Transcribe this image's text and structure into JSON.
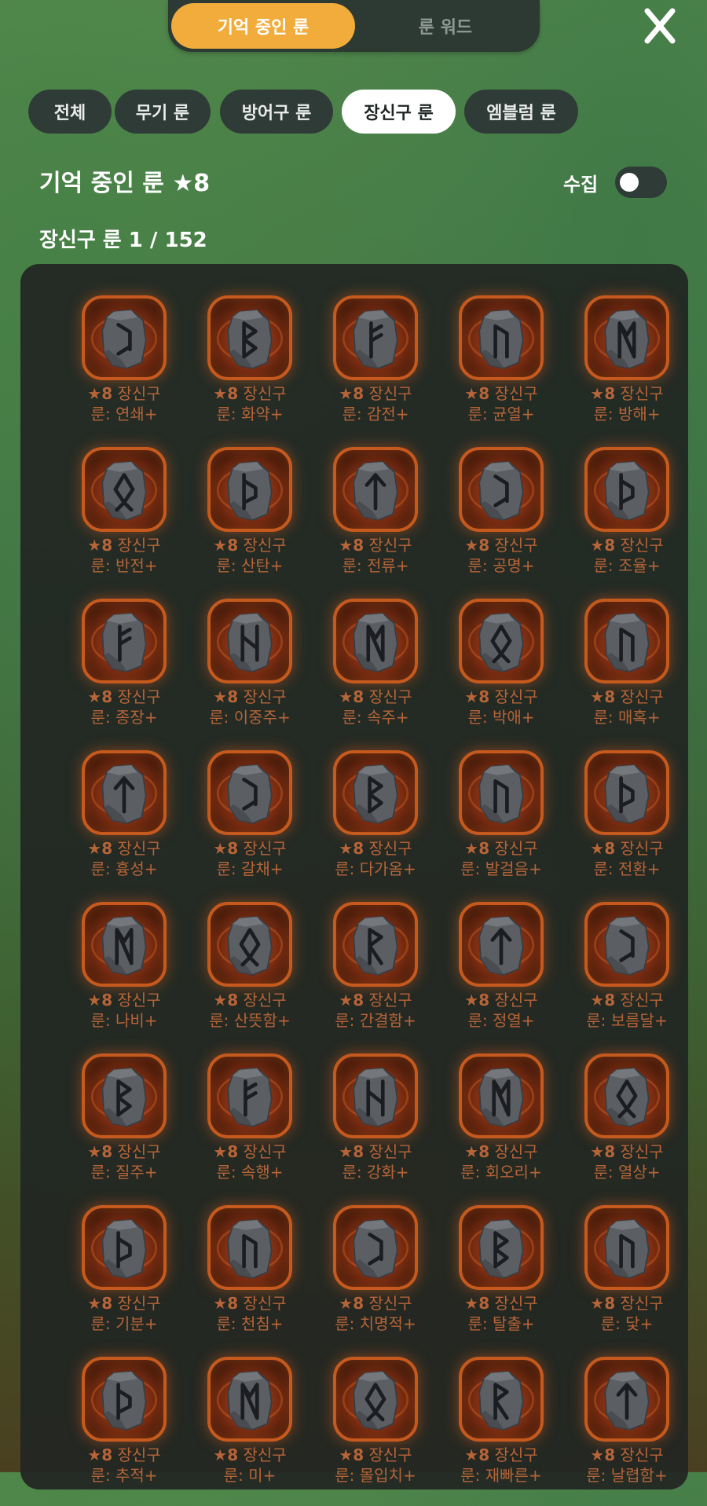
{
  "tabs": {
    "active": "기억 중인 룬",
    "inactive": "룬 워드"
  },
  "filters": [
    "전체",
    "무기 룬",
    "방어구 룬",
    "장신구 룬",
    "엠블럼 룬"
  ],
  "active_filter_index": 3,
  "header": {
    "title": "기억 중인 룬 ★8",
    "collect_label": "수집",
    "collect_toggle_on": false
  },
  "count": {
    "text": "장신구 룬  1 / 152"
  },
  "colors": {
    "accent": "#f2ac3c",
    "label": "#b66438",
    "tile_border": "#c65a1e",
    "panel": "#212622"
  },
  "runes": [
    {
      "star": "★8",
      "type": "장신구",
      "name": "룬: 연쇄+",
      "glyph": "eihwaz"
    },
    {
      "star": "★8",
      "type": "장신구",
      "name": "룬: 화약+",
      "glyph": "berkano"
    },
    {
      "star": "★8",
      "type": "장신구",
      "name": "룬: 감전+",
      "glyph": "fehu"
    },
    {
      "star": "★8",
      "type": "장신구",
      "name": "룬: 균열+",
      "glyph": "uruz"
    },
    {
      "star": "★8",
      "type": "장신구",
      "name": "룬: 방해+",
      "glyph": "mannaz"
    },
    {
      "star": "★8",
      "type": "장신구",
      "name": "룬: 반전+",
      "glyph": "othala"
    },
    {
      "star": "★8",
      "type": "장신구",
      "name": "룬: 산탄+",
      "glyph": "thurisaz"
    },
    {
      "star": "★8",
      "type": "장신구",
      "name": "룬: 전류+",
      "glyph": "tiwaz"
    },
    {
      "star": "★8",
      "type": "장신구",
      "name": "룬: 공명+",
      "glyph": "eihwaz"
    },
    {
      "star": "★8",
      "type": "장신구",
      "name": "룬: 조율+",
      "glyph": "thurisaz"
    },
    {
      "star": "★8",
      "type": "장신구",
      "name": "룬: 종장+",
      "glyph": "fehu"
    },
    {
      "star": "★8",
      "type": "장신구",
      "name": "룬: 이중주+",
      "glyph": "hagalaz"
    },
    {
      "star": "★8",
      "type": "장신구",
      "name": "룬: 속주+",
      "glyph": "mannaz"
    },
    {
      "star": "★8",
      "type": "장신구",
      "name": "룬: 박애+",
      "glyph": "othala"
    },
    {
      "star": "★8",
      "type": "장신구",
      "name": "룬: 매혹+",
      "glyph": "uruz"
    },
    {
      "star": "★8",
      "type": "장신구",
      "name": "룬: 흉성+",
      "glyph": "tiwaz"
    },
    {
      "star": "★8",
      "type": "장신구",
      "name": "룬: 갈채+",
      "glyph": "eihwaz"
    },
    {
      "star": "★8",
      "type": "장신구",
      "name": "룬: 다가옴+",
      "glyph": "berkano"
    },
    {
      "star": "★8",
      "type": "장신구",
      "name": "룬: 발걸음+",
      "glyph": "uruz"
    },
    {
      "star": "★8",
      "type": "장신구",
      "name": "룬: 전환+",
      "glyph": "thurisaz"
    },
    {
      "star": "★8",
      "type": "장신구",
      "name": "룬: 나비+",
      "glyph": "mannaz"
    },
    {
      "star": "★8",
      "type": "장신구",
      "name": "룬: 산뜻함+",
      "glyph": "othala"
    },
    {
      "star": "★8",
      "type": "장신구",
      "name": "룬: 간결함+",
      "glyph": "raidho"
    },
    {
      "star": "★8",
      "type": "장신구",
      "name": "룬: 정열+",
      "glyph": "tiwaz"
    },
    {
      "star": "★8",
      "type": "장신구",
      "name": "룬: 보름달+",
      "glyph": "eihwaz"
    },
    {
      "star": "★8",
      "type": "장신구",
      "name": "룬: 질주+",
      "glyph": "berkano"
    },
    {
      "star": "★8",
      "type": "장신구",
      "name": "룬: 속행+",
      "glyph": "fehu"
    },
    {
      "star": "★8",
      "type": "장신구",
      "name": "룬: 강화+",
      "glyph": "hagalaz"
    },
    {
      "star": "★8",
      "type": "장신구",
      "name": "룬: 회오리+",
      "glyph": "mannaz"
    },
    {
      "star": "★8",
      "type": "장신구",
      "name": "룬: 열상+",
      "glyph": "othala"
    },
    {
      "star": "★8",
      "type": "장신구",
      "name": "룬: 기분+",
      "glyph": "thurisaz"
    },
    {
      "star": "★8",
      "type": "장신구",
      "name": "룬: 천침+",
      "glyph": "uruz"
    },
    {
      "star": "★8",
      "type": "장신구",
      "name": "룬: 치명적+",
      "glyph": "eihwaz"
    },
    {
      "star": "★8",
      "type": "장신구",
      "name": "룬: 탈출+",
      "glyph": "berkano"
    },
    {
      "star": "★8",
      "type": "장신구",
      "name": "룬: 닻+",
      "glyph": "uruz"
    },
    {
      "star": "★8",
      "type": "장신구",
      "name": "룬: 추적+",
      "glyph": "thurisaz"
    },
    {
      "star": "★8",
      "type": "장신구",
      "name": "룬: 미+",
      "glyph": "mannaz"
    },
    {
      "star": "★8",
      "type": "장신구",
      "name": "룬: 몰입치+",
      "glyph": "othala"
    },
    {
      "star": "★8",
      "type": "장신구",
      "name": "룬: 재빠른+",
      "glyph": "raidho"
    },
    {
      "star": "★8",
      "type": "장신구",
      "name": "룬: 날렵함+",
      "glyph": "tiwaz"
    }
  ]
}
